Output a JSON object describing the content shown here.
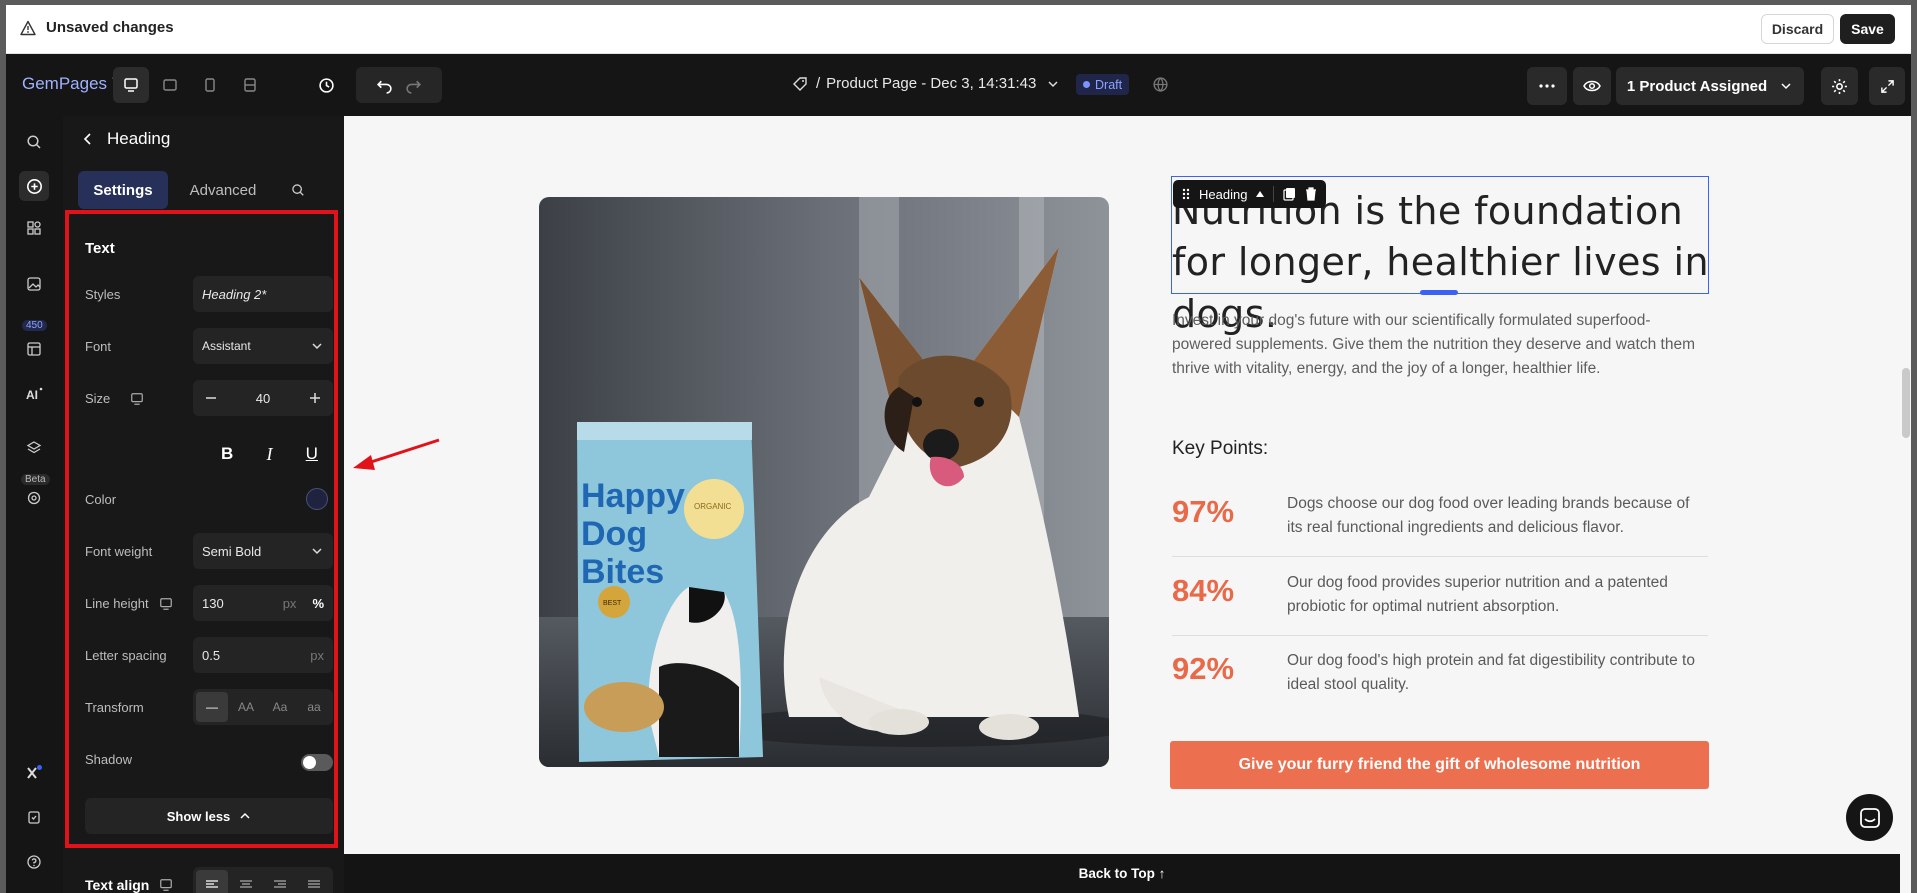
{
  "notice": {
    "message": "Unsaved changes",
    "discard_label": "Discard",
    "save_label": "Save"
  },
  "topbar": {
    "logo": "GemPages 7",
    "page_prefix": "/",
    "page_title": "Product Page - Dec 3, 14:31:43",
    "status": "Draft",
    "assigned_label": "1 Product Assigned"
  },
  "rail": {
    "badge_count": "450",
    "beta_label": "Beta"
  },
  "panel": {
    "title": "Heading",
    "tabs": [
      "Settings",
      "Advanced"
    ],
    "section_title": "Text",
    "styles": {
      "label": "Styles",
      "value": "Heading 2*"
    },
    "font": {
      "label": "Font",
      "value": "Assistant"
    },
    "size": {
      "label": "Size",
      "value": "40"
    },
    "color": {
      "label": "Color",
      "value": "#1f2340"
    },
    "font_weight": {
      "label": "Font weight",
      "value": "Semi Bold"
    },
    "line_height": {
      "label": "Line height",
      "value": "130",
      "unit_px": "px",
      "unit_pct": "%"
    },
    "letter_spacing": {
      "label": "Letter spacing",
      "value": "0.5",
      "unit": "px"
    },
    "transform": {
      "label": "Transform",
      "options": [
        "—",
        "AA",
        "Aa",
        "aa"
      ]
    },
    "shadow": {
      "label": "Shadow"
    },
    "show_less": "Show less",
    "text_align": "Text align"
  },
  "canvas": {
    "heading_tag": "Heading",
    "heading": "Nutrition is the foundation for longer, healthier lives in dogs.",
    "paragraph": "Invest in your dog's future with our scientifically formulated superfood-powered supplements. Give them the nutrition they deserve and watch them thrive with vitality, energy, and the joy of a longer, healthier life.",
    "key_points_title": "Key Points:",
    "key_points": [
      {
        "pct": "97%",
        "text": "Dogs choose our dog food over leading brands because of its real functional ingredients and delicious flavor."
      },
      {
        "pct": "84%",
        "text": "Our dog food provides superior nutrition and a patented probiotic for optimal nutrient absorption."
      },
      {
        "pct": "92%",
        "text": "Our dog food's high protein and fat digestibility contribute to ideal stool quality."
      }
    ],
    "cta": "Give your furry friend the gift of wholesome nutrition",
    "product_bag": {
      "line1": "Happy",
      "line2": "Dog",
      "line3": "Bites",
      "badge": "ORGANIC",
      "seal": "BEST"
    },
    "back_to_top": "Back to Top ↑"
  },
  "colors": {
    "accent": "#ec6f4f",
    "selection": "#3b63f3",
    "highlight": "#e2121a"
  }
}
